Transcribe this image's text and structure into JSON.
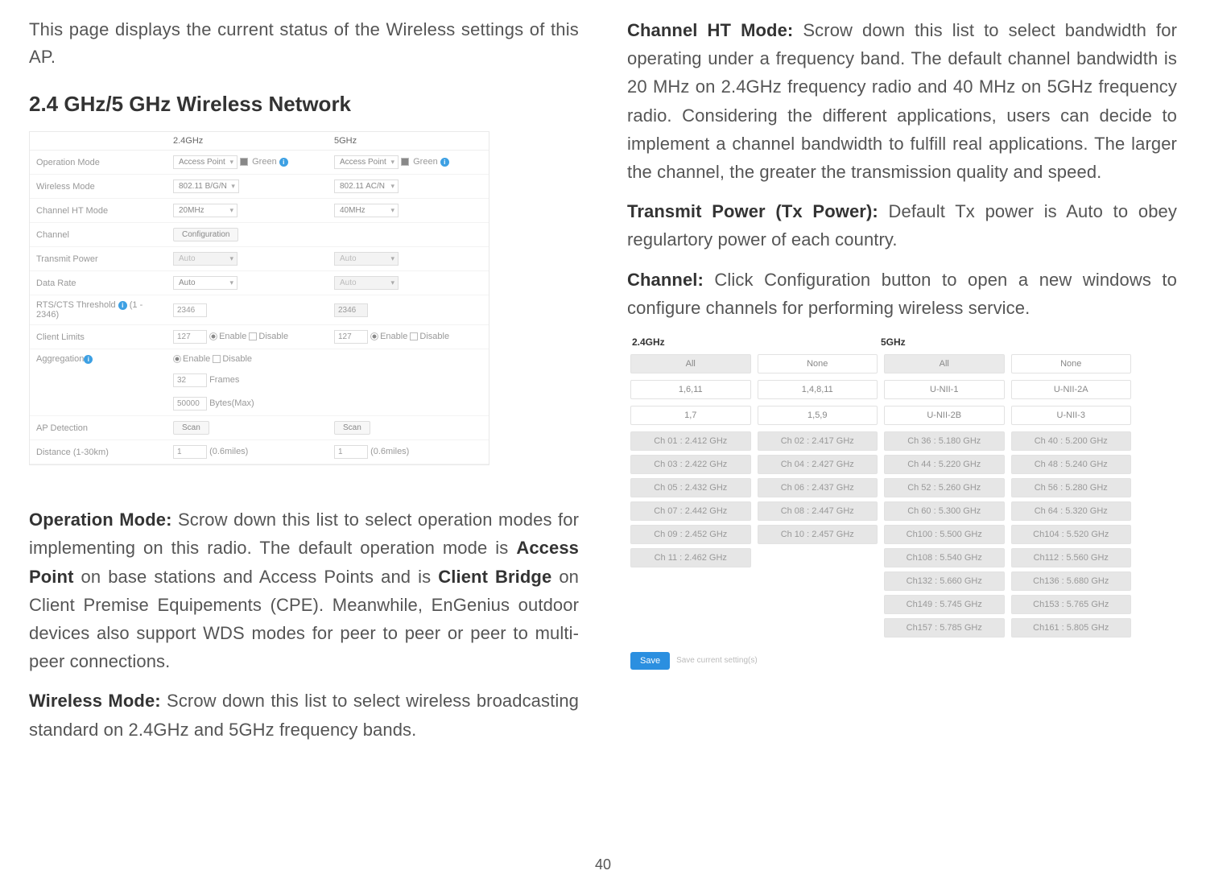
{
  "left": {
    "intro": "This page displays the current status of the Wireless settings of this AP.",
    "section_title": "2.4 GHz/5 GHz Wireless Network",
    "fig1": {
      "hdr_24": "2.4GHz",
      "hdr_5": "5GHz",
      "rows": {
        "op_mode": {
          "label": "Operation Mode",
          "v24": "Access Point",
          "green": "Green",
          "v5": "Access Point"
        },
        "wmode": {
          "label": "Wireless Mode",
          "v24": "802.11 B/G/N",
          "v5": "802.11 AC/N"
        },
        "htmode": {
          "label": "Channel HT Mode",
          "v24": "20MHz",
          "v5": "40MHz"
        },
        "channel": {
          "label": "Channel",
          "btn": "Configuration"
        },
        "txpower": {
          "label": "Transmit Power",
          "v24": "Auto",
          "v5": "Auto"
        },
        "datarate": {
          "label": "Data Rate",
          "v24": "Auto",
          "v5": "Auto"
        },
        "rtscts": {
          "label": "RTS/CTS Threshold",
          "range": "(1 - 2346)",
          "v24": "2346",
          "v5": "2346"
        },
        "climits": {
          "label": "Client Limits",
          "v24": "127",
          "enable": "Enable",
          "disable": "Disable",
          "v5": "127"
        },
        "agg": {
          "label": "Aggregation",
          "enable": "Enable",
          "disable": "Disable",
          "frames": "32",
          "frames_lbl": "Frames",
          "bytes": "50000",
          "bytes_lbl": "Bytes(Max)"
        },
        "apdet": {
          "label": "AP Detection",
          "btn": "Scan"
        },
        "dist": {
          "label": "Distance (1-30km)",
          "v": "1",
          "miles": "(0.6miles)"
        }
      }
    },
    "p_op_mode_1": "Operation Mode:",
    "p_op_mode_2": " Scrow down this list to select operation modes for implementing on this radio. The default operation mode is ",
    "p_op_mode_3": "Access Point",
    "p_op_mode_4": " on base stations and Access Points and is ",
    "p_op_mode_5": "Client Bridge",
    "p_op_mode_6": " on Client Premise Equipements (CPE). Meanwhile, EnGenius outdoor devices also support WDS modes for peer to peer or peer to multi-peer connections.",
    "p_wmode_1": "Wireless Mode:",
    "p_wmode_2": " Scrow down this list to select wireless broadcasting standard on 2.4GHz and 5GHz frequency bands."
  },
  "right": {
    "p_ht_1": "Channel HT Mode:",
    "p_ht_2": " Scrow down this list to select bandwidth for operating under a frequency band. The default channel bandwidth is 20 MHz on 2.4GHz frequency radio and 40 MHz on 5GHz frequency radio. Considering the different applications, users can decide to implement a channel bandwidth to fulfill real applications. The larger the channel, the greater the transmission quality and speed.",
    "p_tx_1": "Transmit Power (Tx Power):",
    "p_tx_2": " Default Tx power is Auto to obey regulartory power of each country.",
    "p_ch_1": "Channel:",
    "p_ch_2": " Click Configuration button to open a new windows to configure channels for performing wireless service.",
    "fig2": {
      "band24": "2.4GHz",
      "band5": "5GHz",
      "row1": [
        "All",
        "None",
        "All",
        "None"
      ],
      "row2": [
        "1,6,11",
        "1,4,8,11",
        "U-NII-1",
        "U-NII-2A"
      ],
      "row3": [
        "1,7",
        "1,5,9",
        "U-NII-2B",
        "U-NII-3"
      ],
      "ch24": [
        "Ch 01 : 2.412 GHz",
        "Ch 02 : 2.417 GHz",
        "Ch 03 : 2.422 GHz",
        "Ch 04 : 2.427 GHz",
        "Ch 05 : 2.432 GHz",
        "Ch 06 : 2.437 GHz",
        "Ch 07 : 2.442 GHz",
        "Ch 08 : 2.447 GHz",
        "Ch 09 : 2.452 GHz",
        "Ch 10 : 2.457 GHz",
        "Ch 11 : 2.462 GHz"
      ],
      "ch5": [
        "Ch 36 : 5.180 GHz",
        "Ch 40 : 5.200 GHz",
        "Ch 44 : 5.220 GHz",
        "Ch 48 : 5.240 GHz",
        "Ch 52 : 5.260 GHz",
        "Ch 56 : 5.280 GHz",
        "Ch 60 : 5.300 GHz",
        "Ch 64 : 5.320 GHz",
        "Ch100 : 5.500 GHz",
        "Ch104 : 5.520 GHz",
        "Ch108 : 5.540 GHz",
        "Ch112 : 5.560 GHz",
        "Ch132 : 5.660 GHz",
        "Ch136 : 5.680 GHz",
        "Ch149 : 5.745 GHz",
        "Ch153 : 5.765 GHz",
        "Ch157 : 5.785 GHz",
        "Ch161 : 5.805 GHz"
      ],
      "save": "Save",
      "save_hint": "Save current setting(s)"
    }
  },
  "page_number": "40"
}
